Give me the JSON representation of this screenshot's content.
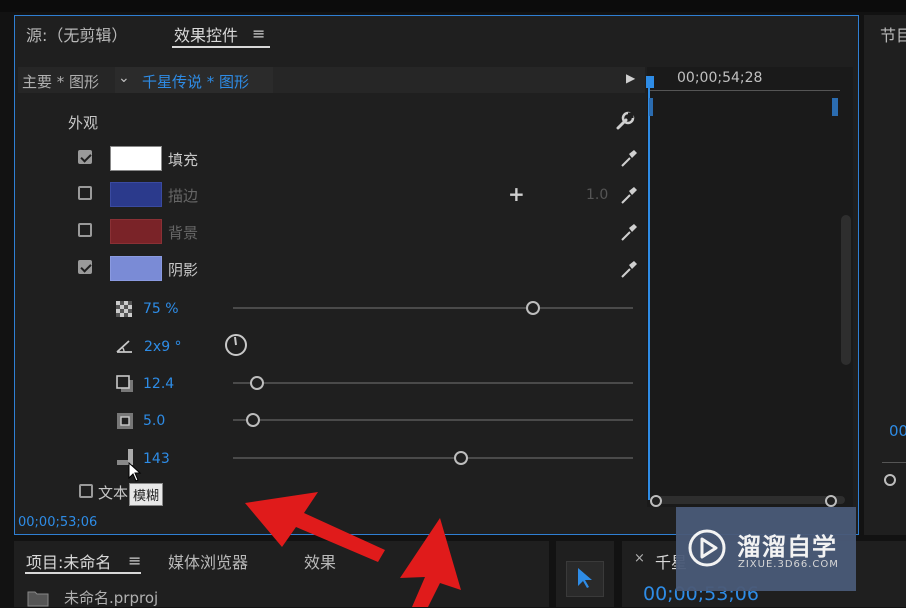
{
  "tabs": {
    "source": "源:（无剪辑）",
    "effect_controls": "效果控件",
    "program": "节目"
  },
  "header": {
    "master": "主要 * 图形",
    "clip": "千星传说 * 图形",
    "timecode": "00;00;54;28"
  },
  "appearance": {
    "title": "外观",
    "fill": {
      "label": "填充",
      "checked": true,
      "color": "#ffffff"
    },
    "stroke": {
      "label": "描边",
      "checked": false,
      "color": "#2b3a8c",
      "width": "1.0"
    },
    "background": {
      "label": "背景",
      "checked": false,
      "color": "#7a2328"
    },
    "shadow": {
      "label": "阴影",
      "checked": true,
      "color": "#7a8bd6"
    }
  },
  "shadow_params": {
    "opacity": "75 %",
    "angle": "2x9 °",
    "distance": "12.4",
    "size": "5.0",
    "blur": "143",
    "opacity_level": 0.75,
    "distance_level": 0.06,
    "size_level": 0.05,
    "blur_level": 0.57
  },
  "text_section": {
    "label": "文本",
    "tooltip": "模糊"
  },
  "footer_time": "00;00;53;06",
  "bottom": {
    "project": "项目:未命名",
    "media_browser": "媒体浏览器",
    "effects": "效果",
    "file": "未命名.prproj",
    "seq_tab": "千星",
    "seq_time": "00;00;53;06"
  },
  "partial_right": "00",
  "watermark": {
    "title": "溜溜自学",
    "subtitle": "ZIXUE.3D66.COM"
  },
  "colors": {
    "accent": "#2e8ce6",
    "arrow": "#e01b1b"
  }
}
